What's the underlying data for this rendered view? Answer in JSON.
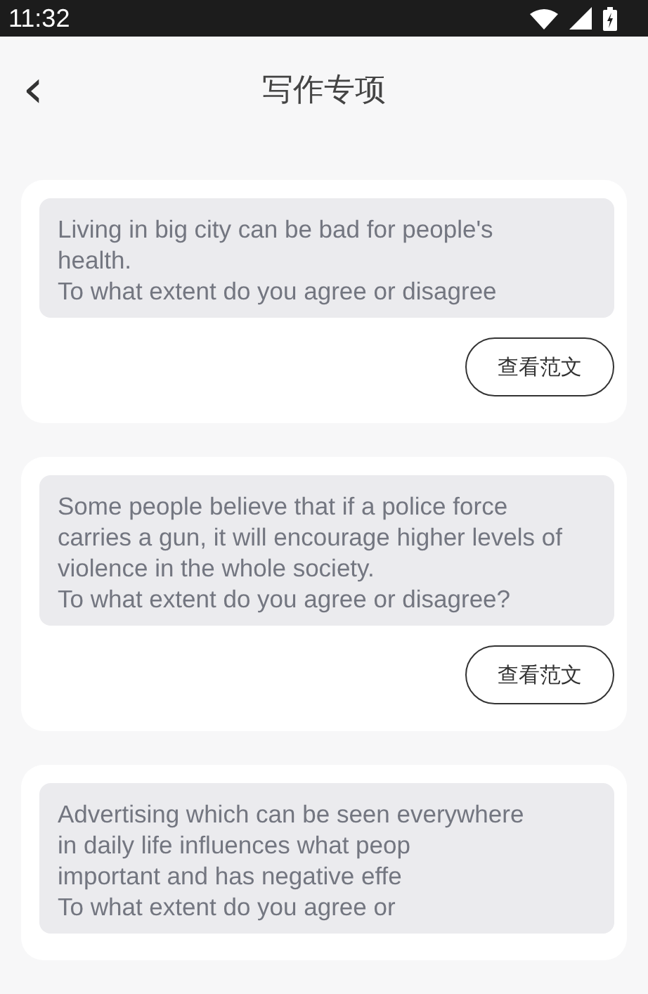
{
  "status_bar": {
    "time": "11:32"
  },
  "header": {
    "back": "‹",
    "title": "写作专项"
  },
  "cards": [
    {
      "prompt": "Living in big city can be bad for people's\nhealth.\nTo what extent do you agree or disagree",
      "button": "查看范文"
    },
    {
      "prompt": "Some people believe that if a police force\ncarries a gun, it will encourage higher levels of\nviolence in the whole society.\nTo what extent do you agree or disagree?",
      "button": "查看范文"
    },
    {
      "prompt": "Advertising which can be seen everywhere\nin daily life influences what peop\nimportant and has negative effe\nTo what extent do you agree or"
    }
  ]
}
